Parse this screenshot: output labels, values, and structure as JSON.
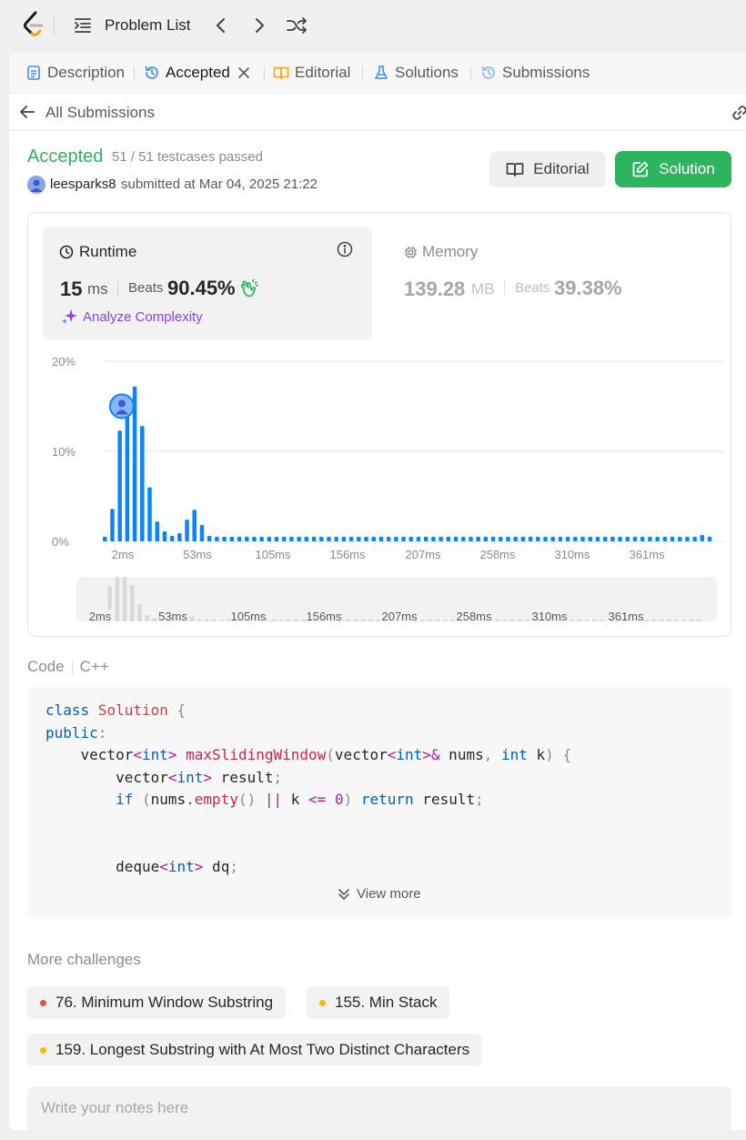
{
  "topbar": {
    "problem_list_label": "Problem List"
  },
  "tabs": [
    {
      "label": "Description",
      "icon": "description-icon"
    },
    {
      "label": "Accepted",
      "icon": "history-icon",
      "active": true
    },
    {
      "label": "Editorial",
      "icon": "book-icon"
    },
    {
      "label": "Solutions",
      "icon": "flask-icon"
    },
    {
      "label": "Submissions",
      "icon": "history-icon"
    }
  ],
  "back": {
    "label": "All Submissions"
  },
  "submission": {
    "status": "Accepted",
    "testcases": "51 / 51 testcases passed",
    "user": "leesparks8",
    "submitted": "submitted at Mar 04, 2025 21:22",
    "editorial_btn": "Editorial",
    "solution_btn": "Solution",
    "status_color": "#2db55d"
  },
  "runtime": {
    "title": "Runtime",
    "value": "15",
    "unit": "ms",
    "beats_label": "Beats",
    "beats_pct": "90.45%",
    "analyze": "Analyze Complexity"
  },
  "memory": {
    "title": "Memory",
    "value": "139.28",
    "unit": "MB",
    "beats_label": "Beats",
    "beats_pct": "39.38%"
  },
  "chart_data": {
    "type": "bar",
    "y_ticks": [
      "20%",
      "10%",
      "0%"
    ],
    "x_ticks": [
      "2ms",
      "53ms",
      "105ms",
      "156ms",
      "207ms",
      "258ms",
      "310ms",
      "361ms"
    ],
    "ylim": [
      0,
      20
    ],
    "values": [
      0.5,
      3.6,
      12.3,
      15.5,
      17.2,
      12.8,
      6.0,
      2.2,
      1.1,
      0.6,
      0.9,
      2.4,
      3.5,
      1.8,
      0.6,
      0.5,
      0.5,
      0.5,
      0.5,
      0.5,
      0.5,
      0.5,
      0.5,
      0.5,
      0.5,
      0.5,
      0.5,
      0.5,
      0.5,
      0.5,
      0.5,
      0.5,
      0.5,
      0.5,
      0.5,
      0.5,
      0.5,
      0.5,
      0.5,
      0.5,
      0.5,
      0.5,
      0.5,
      0.5,
      0.5,
      0.5,
      0.5,
      0.5,
      0.5,
      0.5,
      0.5,
      0.5,
      0.5,
      0.5,
      0.5,
      0.5,
      0.5,
      0.5,
      0.5,
      0.5,
      0.5,
      0.5,
      0.5,
      0.5,
      0.5,
      0.5,
      0.5,
      0.5,
      0.5,
      0.5,
      0.5,
      0.5,
      0.5,
      0.5,
      0.5,
      0.5,
      0.5,
      0.5,
      0.5,
      0.5,
      0.7,
      0.5
    ],
    "marker_index": 3,
    "marker_value": 15,
    "bar_color": "#0a84ff",
    "grid": true
  },
  "code": {
    "label": "Code",
    "language": "C++",
    "lines": [
      "class Solution {",
      "public:",
      "    vector<int> maxSlidingWindow(vector<int>& nums, int k) {",
      "        vector<int> result;",
      "        if (nums.empty() || k <= 0) return result;",
      "",
      "",
      "        deque<int> dq;"
    ],
    "view_more": "View more"
  },
  "more": {
    "title": "More challenges",
    "items": [
      {
        "label": "76. Minimum Window Substring",
        "color": "#ef4743"
      },
      {
        "label": "155. Min Stack",
        "color": "#ffb700"
      },
      {
        "label": "159. Longest Substring with At Most Two Distinct Characters",
        "color": "#ffb700"
      }
    ]
  },
  "notes": {
    "placeholder": "Write your notes here"
  }
}
